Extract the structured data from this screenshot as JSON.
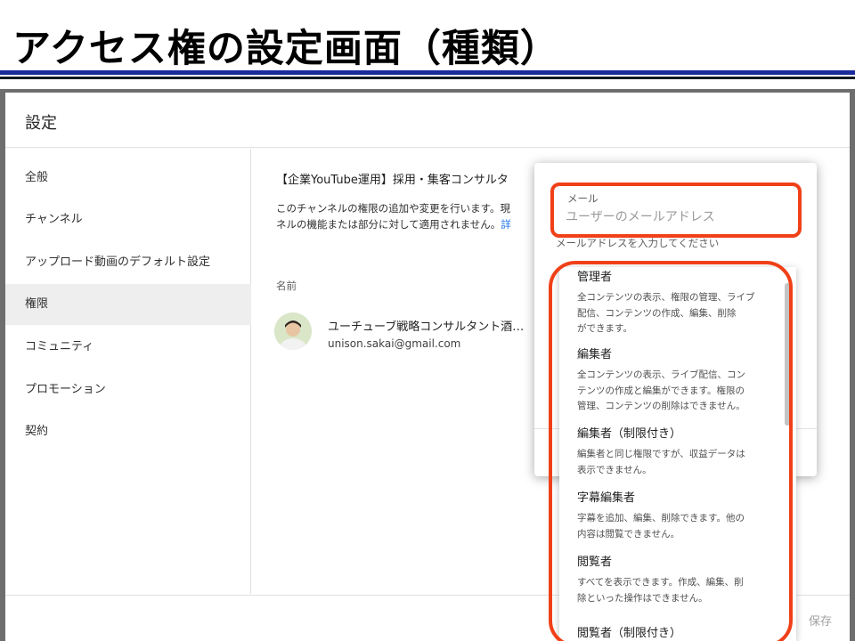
{
  "slide": {
    "title": "アクセス権の設定画面（種類）"
  },
  "dialog": {
    "title": "設定",
    "save_label": "保存"
  },
  "sidebar": {
    "items": [
      {
        "label": "全般"
      },
      {
        "label": "チャンネル"
      },
      {
        "label": "アップロード動画のデフォルト設定"
      },
      {
        "label": "権限",
        "active": true
      },
      {
        "label": "コミュニティ"
      },
      {
        "label": "プロモーション"
      },
      {
        "label": "契約"
      }
    ]
  },
  "main": {
    "channel_title": "【企業YouTube運用】採用・集客コンサルタ",
    "desc_line1": "このチャンネルの権限の追加や変更を行います。現",
    "desc_line2": "ネルの機能または部分に対して適用されません。",
    "desc_link": "詳",
    "column_name": "名前",
    "user": {
      "name": "ユーチューブ戦略コンサルタント酒…",
      "email": "unison.sakai@gmail.com"
    }
  },
  "popover": {
    "email_label": "メール",
    "email_placeholder": "ユーザーのメールアドレス",
    "email_helper": "メールアドレスを入力してください"
  },
  "roles": [
    {
      "name": "管理者",
      "desc": [
        "全コンテンツの表示、権限の管理、ライブ",
        "配信、コンテンツの作成、編集、削除",
        "ができます。"
      ]
    },
    {
      "name": "編集者",
      "desc": [
        "全コンテンツの表示、ライブ配信、コン",
        "テンツの作成と編集ができます。権限の",
        "管理、コンテンツの削除はできません。"
      ]
    },
    {
      "name": "編集者（制限付き）",
      "desc": [
        "編集者と同じ権限ですが、収益データは",
        "表示できません。"
      ]
    },
    {
      "name": "字幕編集者",
      "desc": [
        "字幕を追加、編集、削除できます。他の",
        "内容は閲覧できません。"
      ]
    },
    {
      "name": "閲覧者",
      "desc": [
        "すべてを表示できます。作成、編集、削",
        "除といった操作はできません。"
      ]
    },
    {
      "name": "閲覧者（制限付き）",
      "desc": []
    }
  ],
  "colors": {
    "highlight": "#f04018",
    "title_rule": "#1a2a9a",
    "link": "#1a73e8"
  }
}
